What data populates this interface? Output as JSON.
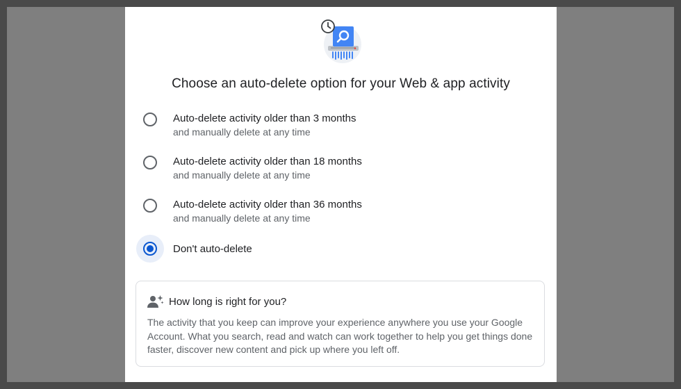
{
  "dialog": {
    "title": "Choose an auto-delete option for your Web & app activity",
    "illustration": "shredder-search-clock-icon",
    "selected_option": 3,
    "options": [
      {
        "title": "Auto-delete activity older than 3 months",
        "subtitle": "and manually delete at any time"
      },
      {
        "title": "Auto-delete activity older than 18 months",
        "subtitle": "and manually delete at any time"
      },
      {
        "title": "Auto-delete activity older than 36 months",
        "subtitle": "and manually delete at any time"
      },
      {
        "title": "Don't auto-delete",
        "subtitle": ""
      }
    ]
  },
  "info": {
    "icon": "person-sparkle-icon",
    "title": "How long is right for you?",
    "body": "The activity that you keep can improve your experience anywhere you use your Google Account. What you search, read and watch can work together to help you get things done faster, discover new content and pick up where you left off."
  },
  "colors": {
    "accent": "#0b57d0",
    "selected_bg": "#e8eef9",
    "text_primary": "#202124",
    "text_secondary": "#5f6368",
    "backdrop": "#7f7f7f"
  }
}
